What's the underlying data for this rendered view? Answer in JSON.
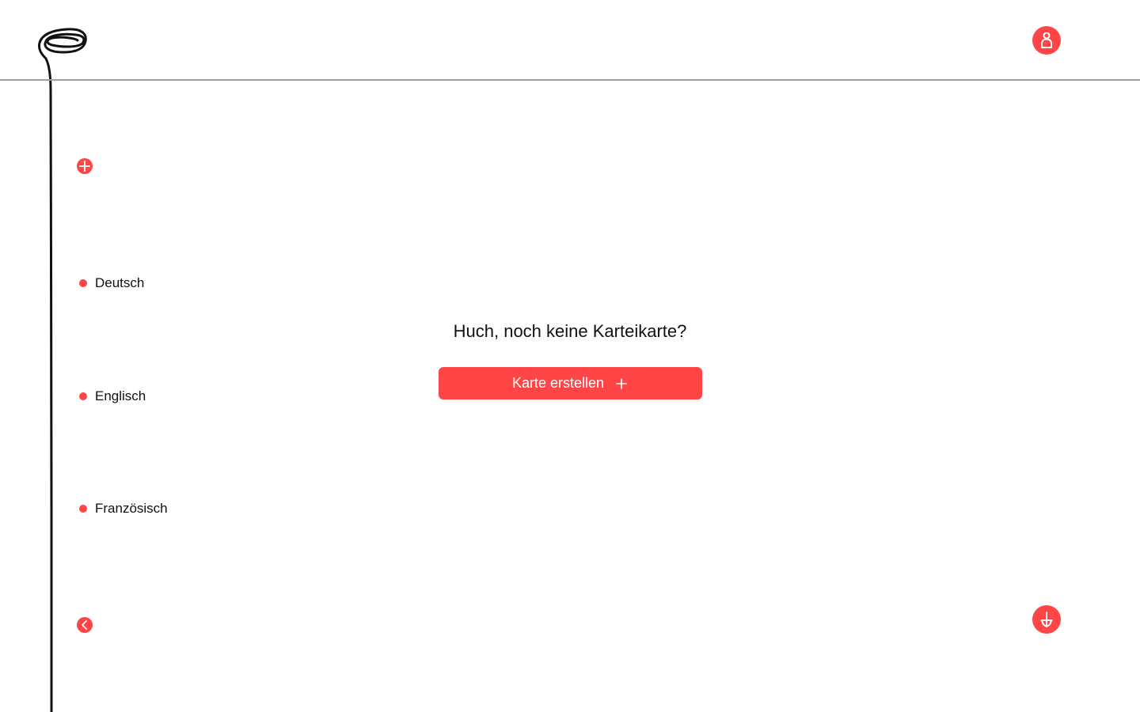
{
  "theme": {
    "accent": "#ff4545",
    "divider": "#9e9e9e",
    "text": "#111111"
  },
  "header": {
    "logo_icon": "scribble-spiral-logo",
    "account_icon": "user-icon"
  },
  "sidebar": {
    "add_icon": "plus-circle-icon",
    "back_icon": "chevron-left-icon",
    "decks": [
      {
        "label": "Deutsch"
      },
      {
        "label": "Englisch"
      },
      {
        "label": "Französisch"
      }
    ]
  },
  "main": {
    "empty_title": "Huch, noch keine Karteikarte?",
    "create_button_label": "Karte erstellen",
    "create_button_icon": "plus-icon"
  },
  "footer": {
    "download_icon": "download-arrow-icon"
  }
}
